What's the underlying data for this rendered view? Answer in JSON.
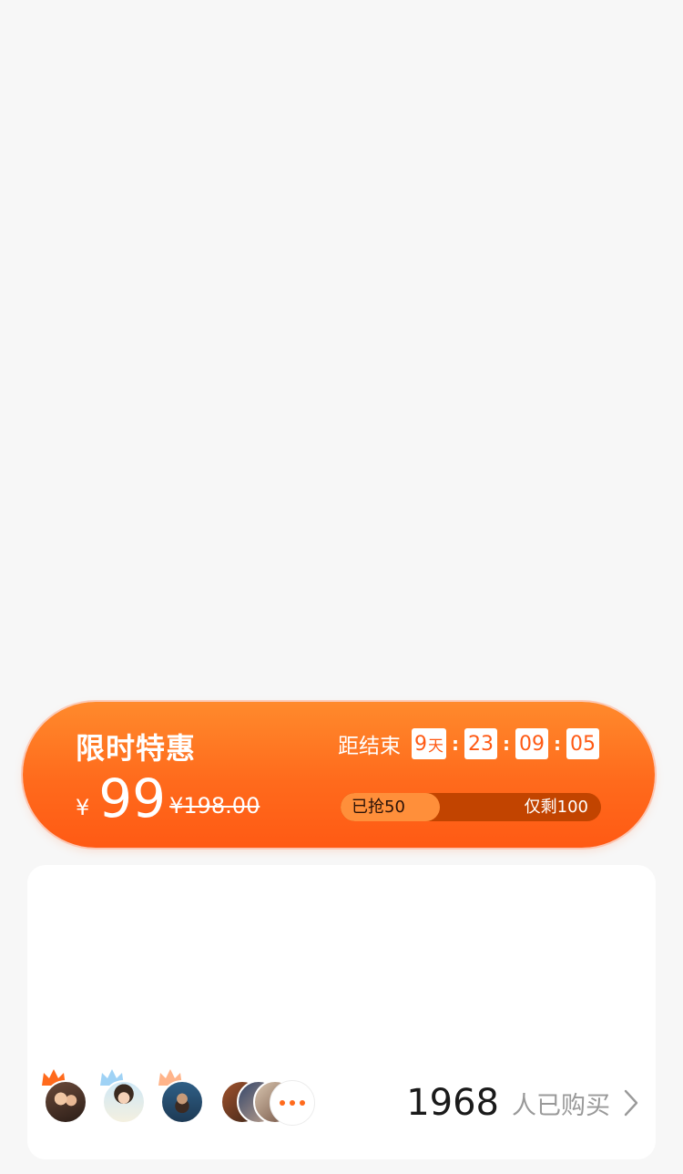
{
  "promo": {
    "title": "限时特惠",
    "countdown_label": "距结束",
    "countdown": {
      "days": "9",
      "day_unit": "天",
      "hours": "23",
      "minutes": "09",
      "seconds": "05",
      "separator": ":"
    },
    "currency": "¥",
    "price": "99",
    "original_price": "¥198.00",
    "stock": {
      "sold_label": "已抢50",
      "remaining_label": "仅剩100",
      "sold_fraction": 0.38
    }
  },
  "buyers": {
    "count": "1968",
    "label": "人已购买"
  },
  "colors": {
    "accent": "#ff6a1c",
    "bar_track": "#c24400",
    "bar_fill": "#ff8f3a",
    "crown_orange": "#ff6a1c",
    "crown_blue": "#9fd2f5",
    "crown_peach": "#ffb48a"
  },
  "icons": {
    "crowns": [
      "crown-orange-icon",
      "crown-blue-icon",
      "crown-peach-icon"
    ],
    "more": "more-dots-icon",
    "arrow": "chevron-right-icon"
  }
}
